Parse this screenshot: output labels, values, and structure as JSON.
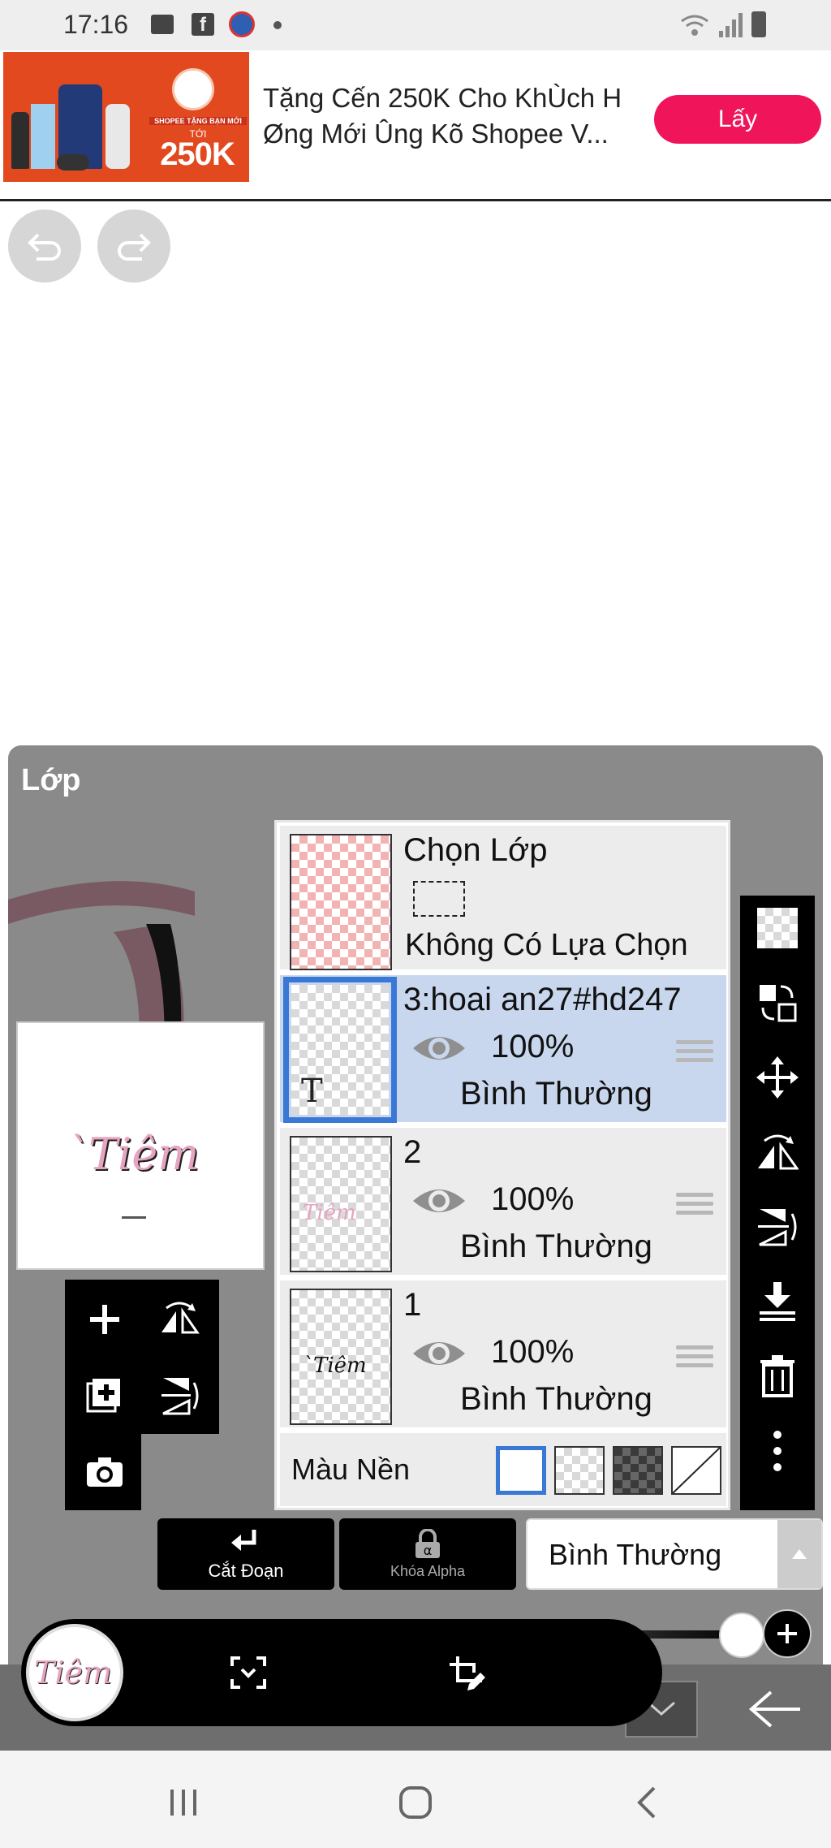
{
  "status_bar": {
    "time": "17:16"
  },
  "ad": {
    "promo_label": "SHOPEE TẶNG BẠN MỚI",
    "promo_up_to": "TỚI",
    "promo_amount": "250K",
    "text_line1": "Tặng Cến 250K Cho KhÙch H",
    "text_line2": "Øng Mới Ûng Kõ Shopee V...",
    "cta": "Lấy",
    "cta_color": "#f0145a"
  },
  "panel": {
    "title": "Lớp",
    "layers_header": {
      "title": "Chọn Lớp",
      "no_selection": "Không Có Lựa Chọn"
    },
    "layers": [
      {
        "name": "3:hoai an27#hd247",
        "opacity": "100%",
        "blend": "Bình Thường",
        "selected": true,
        "type_icon": "T"
      },
      {
        "name": "2",
        "opacity": "100%",
        "blend": "Bình Thường",
        "selected": false
      },
      {
        "name": "1",
        "opacity": "100%",
        "blend": "Bình Thường",
        "selected": false
      }
    ],
    "background_label": "Màu Nền",
    "clip_label": "Cắt Đoạn",
    "alpha_lock_label": "Khóa Alpha",
    "blend_mode_value": "Bình Thường",
    "accent_color": "#3a78d6",
    "selected_row_color": "#c9d7ee"
  },
  "icons": {
    "undo": "undo-icon",
    "redo": "redo-icon",
    "add_layer": "plus-icon",
    "add_copy": "add-copy-icon",
    "camera": "camera-icon",
    "flip_h": "flip-horizontal-icon",
    "flip_v": "flip-vertical-icon",
    "checker": "transparency-icon",
    "move": "move-icon",
    "merge_down": "merge-down-icon",
    "trash": "trash-icon",
    "more": "more-vertical-icon"
  }
}
